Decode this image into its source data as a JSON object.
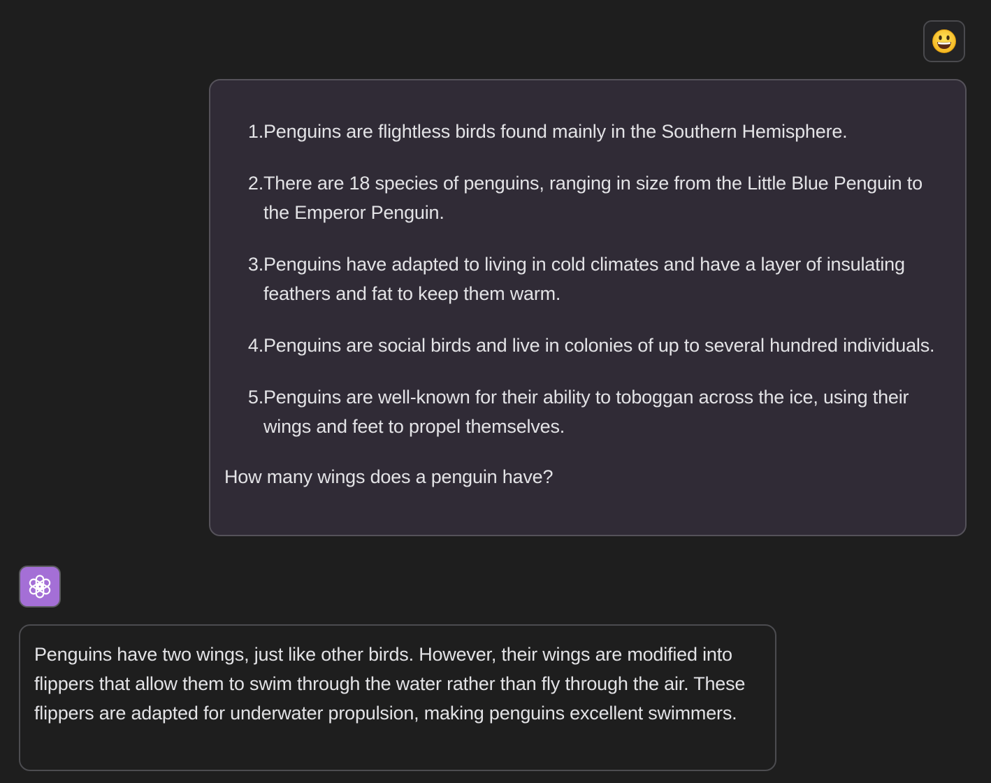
{
  "user_message": {
    "avatar_icon": "smiley-face-icon",
    "list": [
      {
        "number": "1.",
        "text": "Penguins are flightless birds found mainly in the Southern Hemisphere."
      },
      {
        "number": "2.",
        "text": "There are 18 species of penguins, ranging in size from the Little Blue Penguin to the Emperor Penguin."
      },
      {
        "number": "3.",
        "text": "Penguins have adapted to living in cold climates and have a layer of insulating feathers and fat to keep them warm."
      },
      {
        "number": "4.",
        "text": "Penguins are social birds and live in colonies of up to several hundred individuals."
      },
      {
        "number": "5.",
        "text": "Penguins are well-known for their ability to toboggan across the ice, using their wings and feet to propel themselves."
      }
    ],
    "question": "How many wings does a penguin have?"
  },
  "assistant_message": {
    "avatar_icon": "openai-logo-icon",
    "text": "Penguins have two wings, just like other birds. However, their wings are modified into flippers that allow them to swim through the water rather than fly through the air. These flippers are adapted for underwater propulsion, making penguins excellent swimmers."
  },
  "colors": {
    "background": "#1e1e1e",
    "user_bubble": "#302b36",
    "bot_avatar": "#a46fd6"
  }
}
